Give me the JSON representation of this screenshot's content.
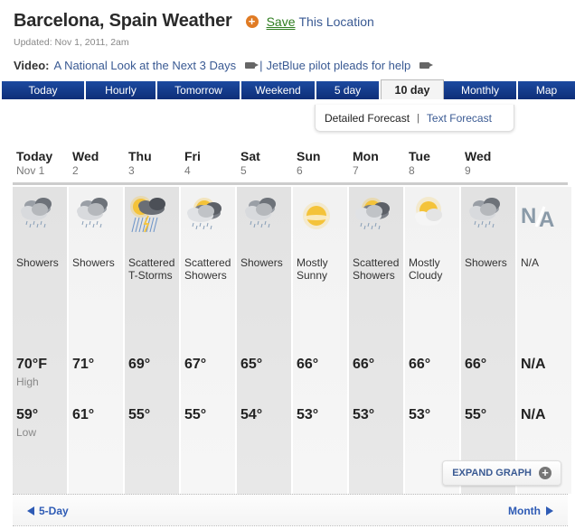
{
  "header": {
    "title": "Barcelona, Spain Weather",
    "save_label": "Save",
    "save_suffix": "This Location",
    "updated": "Updated: Nov 1, 2011, 2am"
  },
  "video": {
    "label": "Video:",
    "link1": "A National Look at the Next 3 Days",
    "separator": "|",
    "link2": "JetBlue pilot pleads for help"
  },
  "tabs": [
    {
      "label": "Today",
      "active": false
    },
    {
      "label": "Hourly",
      "active": false
    },
    {
      "label": "Tomorrow",
      "active": false
    },
    {
      "label": "Weekend",
      "active": false
    },
    {
      "label": "5 day",
      "active": false
    },
    {
      "label": "10 day",
      "active": true
    },
    {
      "label": "Monthly",
      "active": false
    },
    {
      "label": "Map",
      "active": false
    }
  ],
  "subtabs": {
    "active": "Detailed Forecast",
    "separator": "|",
    "other": "Text Forecast"
  },
  "forecast": {
    "high_label": "High",
    "low_label": "Low",
    "days": [
      {
        "day": "Today",
        "date": "Nov 1",
        "icon": "showers-icon",
        "condition": "Showers",
        "high": "70°F",
        "low": "59°"
      },
      {
        "day": "Wed",
        "date": "2",
        "icon": "showers-icon",
        "condition": "Showers",
        "high": "71°",
        "low": "61°"
      },
      {
        "day": "Thu",
        "date": "3",
        "icon": "scattered-tstorms-icon",
        "condition": "Scattered T-Storms",
        "high": "69°",
        "low": "55°"
      },
      {
        "day": "Fri",
        "date": "4",
        "icon": "scattered-showers-icon",
        "condition": "Scattered Showers",
        "high": "67°",
        "low": "55°"
      },
      {
        "day": "Sat",
        "date": "5",
        "icon": "showers-icon",
        "condition": "Showers",
        "high": "65°",
        "low": "54°"
      },
      {
        "day": "Sun",
        "date": "6",
        "icon": "mostly-sunny-icon",
        "condition": "Mostly Sunny",
        "high": "66°",
        "low": "53°"
      },
      {
        "day": "Mon",
        "date": "7",
        "icon": "scattered-showers-icon",
        "condition": "Scattered Showers",
        "high": "66°",
        "low": "53°"
      },
      {
        "day": "Tue",
        "date": "8",
        "icon": "mostly-cloudy-icon",
        "condition": "Mostly Cloudy",
        "high": "66°",
        "low": "53°"
      },
      {
        "day": "Wed",
        "date": "9",
        "icon": "showers-icon",
        "condition": "Showers",
        "high": "66°",
        "low": "55°"
      },
      {
        "day": "",
        "date": "",
        "icon": "na-icon",
        "condition": "N/A",
        "high": "N/A",
        "low": "N/A"
      }
    ]
  },
  "expand_graph": "EXPAND GRAPH",
  "footer": {
    "prev": "5-Day",
    "next": "Month"
  },
  "colors": {
    "tab_blue": "#1c4aa0",
    "link_blue": "#3a5a93",
    "save_green": "#2e7d1f",
    "plus_orange": "#e07b24"
  }
}
